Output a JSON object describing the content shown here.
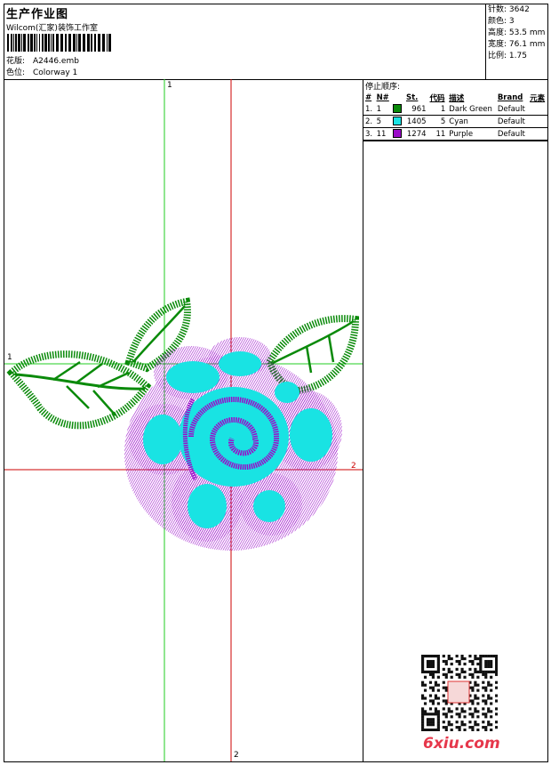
{
  "header": {
    "title": "生产作业图",
    "studio": "Wilcom(汇家)装饰工作室",
    "pattern_label": "花版:",
    "pattern_value": "A2446.emb",
    "colorway_label": "色位:",
    "colorway_value": "Colorway 1"
  },
  "specs": [
    {
      "label": "针数:",
      "value": "3642"
    },
    {
      "label": "颜色:",
      "value": "3"
    },
    {
      "label": "高度:",
      "value": "53.5 mm"
    },
    {
      "label": "宽度:",
      "value": "76.1 mm"
    },
    {
      "label": "比例:",
      "value": "1.75"
    }
  ],
  "stop_sequence": {
    "heading": "停止顺序:",
    "columns": [
      "#",
      "N#",
      "St.",
      "代码",
      "描述",
      "Brand",
      "元素"
    ],
    "rows": [
      {
        "idx": "1.",
        "n": "1",
        "color": "#0a8a0a",
        "st": "961",
        "code": "1",
        "desc": "Dark Green",
        "brand": "Default"
      },
      {
        "idx": "2.",
        "n": "5",
        "color": "#19e3e3",
        "st": "1405",
        "code": "5",
        "desc": "Cyan",
        "brand": "Default"
      },
      {
        "idx": "3.",
        "n": "11",
        "color": "#9a0bc9",
        "st": "1274",
        "code": "11",
        "desc": "Purple",
        "brand": "Default"
      }
    ]
  },
  "axes": {
    "v1": "1",
    "h1": "1",
    "h2": "2",
    "v2": "2",
    "green": "#22cc22",
    "red": "#cc0000"
  },
  "watermark": "6xiu.com"
}
